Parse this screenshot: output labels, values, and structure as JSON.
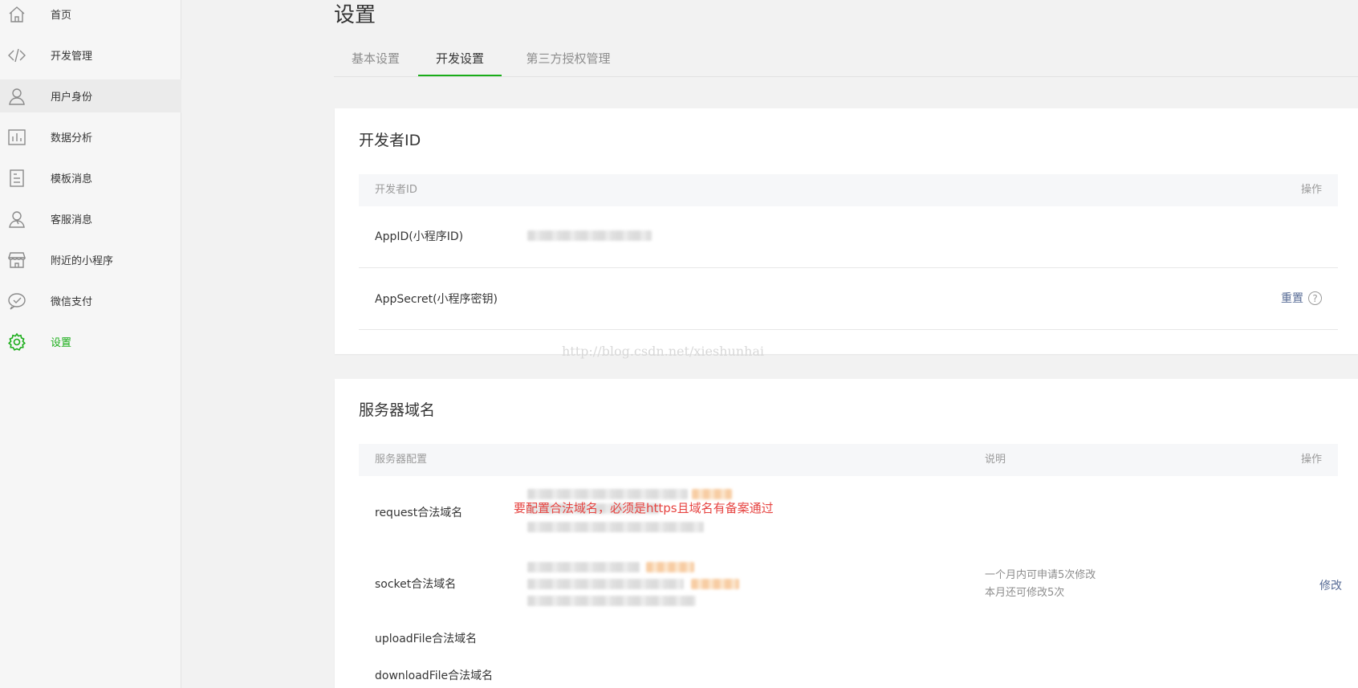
{
  "sidebar": {
    "items": [
      {
        "label": "首页",
        "icon": "home-icon"
      },
      {
        "label": "开发管理",
        "icon": "code-icon"
      },
      {
        "label": "用户身份",
        "icon": "user-icon"
      },
      {
        "label": "数据分析",
        "icon": "bar-chart-icon"
      },
      {
        "label": "模板消息",
        "icon": "document-icon"
      },
      {
        "label": "客服消息",
        "icon": "customer-service-icon"
      },
      {
        "label": "附近的小程序",
        "icon": "store-icon"
      },
      {
        "label": "微信支付",
        "icon": "wechat-pay-icon"
      },
      {
        "label": "设置",
        "icon": "gear-icon"
      }
    ],
    "active_color": "#1aad19"
  },
  "page": {
    "title": "设置",
    "tabs": [
      {
        "label": "基本设置"
      },
      {
        "label": "开发设置"
      },
      {
        "label": "第三方授权管理"
      }
    ]
  },
  "developer_id": {
    "title": "开发者ID",
    "header": {
      "col1": "开发者ID",
      "col2": "操作"
    },
    "rows": [
      {
        "label": "AppID(小程序ID)"
      },
      {
        "label": "AppSecret(小程序密钥)",
        "action": "重置",
        "help": "?"
      }
    ]
  },
  "server_domain": {
    "title": "服务器域名",
    "header": {
      "col1": "服务器配置",
      "col2": "说明",
      "col3": "操作"
    },
    "rows": [
      {
        "label": "request合法域名"
      },
      {
        "label": "socket合法域名"
      },
      {
        "label": "uploadFile合法域名"
      },
      {
        "label": "downloadFile合法域名"
      }
    ],
    "description": [
      "一个月内可申请5次修改",
      "本月还可修改5次"
    ],
    "action": "修改",
    "annotation": "要配置合法域名，必须是https且域名有备案通过"
  },
  "watermark": "http://blog.csdn.net/xieshunhai"
}
